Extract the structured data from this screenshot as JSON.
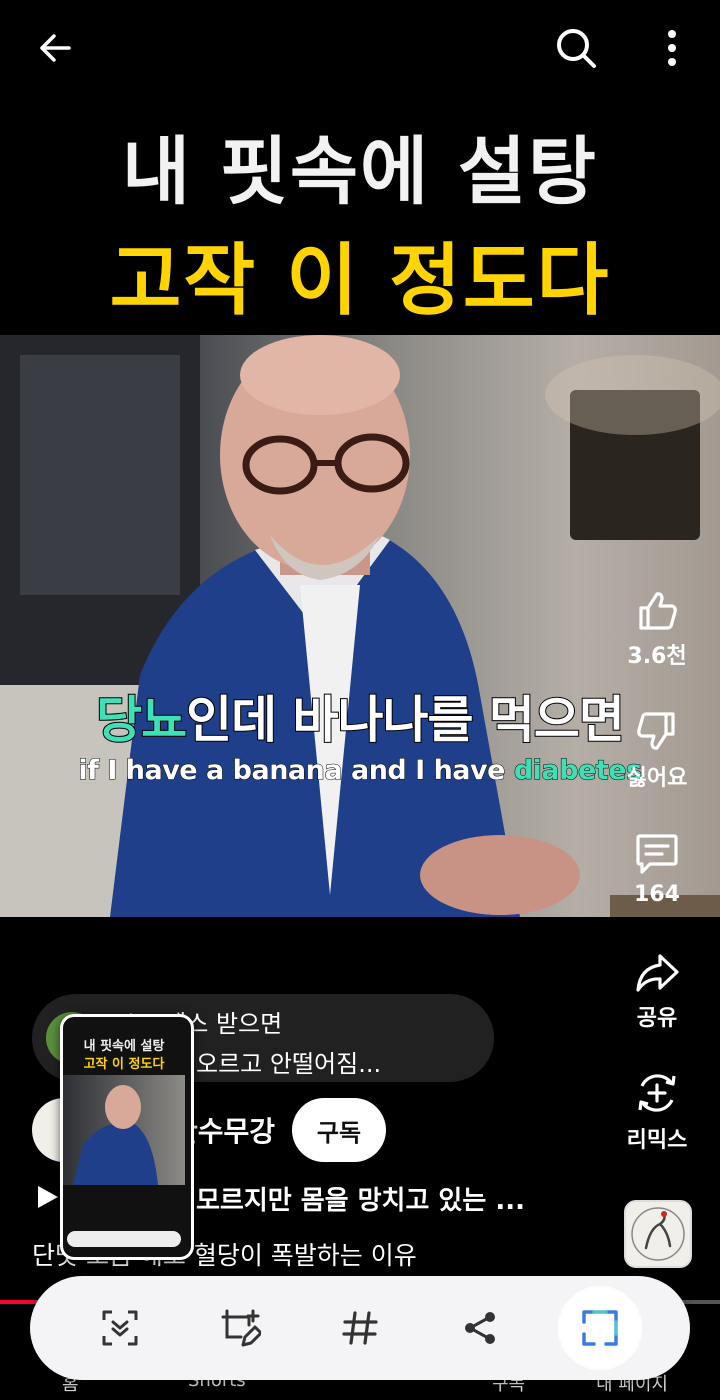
{
  "title": {
    "line1": "내 핏속에 설탕",
    "line2": "고작 이 정도다"
  },
  "video": {
    "subtitle_ko_highlight": "당뇨",
    "subtitle_ko_rest": "인데 바나나를 먹으면",
    "subtitle_en_plain": "if I have a banana and I have ",
    "subtitle_en_highlight": "diabetes"
  },
  "rail": {
    "like_count": "3.6천",
    "dislike_label": "싫어요",
    "comment_count": "164",
    "share_label": "공유",
    "remix_label": "리믹스"
  },
  "comment": {
    "line1": "스트레스 받으면",
    "line2": "오르고 안떨어짐..."
  },
  "channel": {
    "name": "한수무강",
    "subscribe_label": "구독"
  },
  "description": {
    "line1": "모르지만 몸을 망치고 있는 ...",
    "line2": "단맛 조금 해도 혈당이 폭발하는 이유"
  },
  "preview": {
    "title1": "내 핏속에 설탕",
    "title2": "고작 이 정도다"
  },
  "bottom_nav_partial": {
    "home": "홈",
    "shorts": "Shorts",
    "subs": "구독",
    "mypage": "내 페이지"
  },
  "colors": {
    "title_yellow": "#ffd400",
    "subtitle_highlight": "#3fe0b5",
    "progress_red": "#ff0033"
  },
  "progress": {
    "watched_fraction": 0.05
  }
}
